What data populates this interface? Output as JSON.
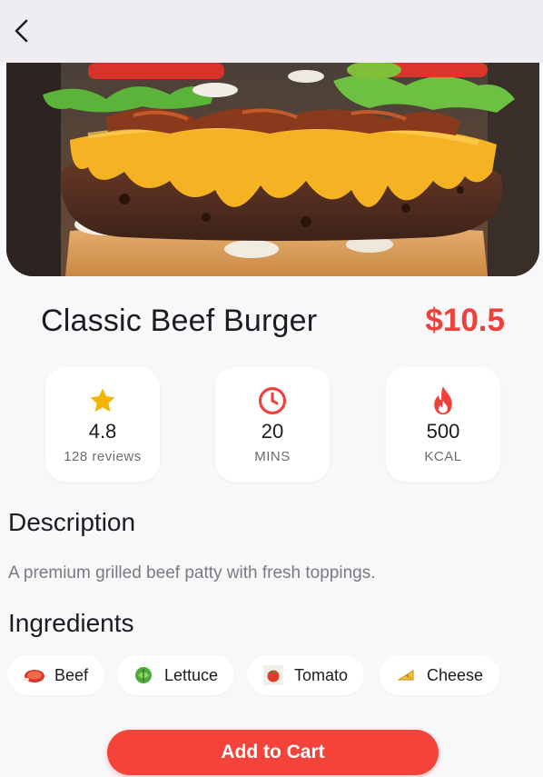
{
  "product": {
    "name": "Classic Beef Burger",
    "price": "$10.5"
  },
  "stats": [
    {
      "icon": "star-icon",
      "value": "4.8",
      "caption": "128 reviews"
    },
    {
      "icon": "clock-icon",
      "value": "20",
      "caption": "MINS"
    },
    {
      "icon": "fire-icon",
      "value": "500",
      "caption": "KCAL"
    }
  ],
  "description": {
    "heading": "Description",
    "text": "A premium grilled beef patty with fresh toppings."
  },
  "ingredients": {
    "heading": "Ingredients",
    "items": [
      {
        "icon": "meat-icon",
        "label": "Beef"
      },
      {
        "icon": "lettuce-icon",
        "label": "Lettuce"
      },
      {
        "icon": "tomato-icon",
        "label": "Tomato"
      },
      {
        "icon": "cheese-icon",
        "label": "Cheese"
      }
    ]
  },
  "cart_button": {
    "label": "Add to Cart"
  },
  "colors": {
    "accent": "#f4433a",
    "price": "#f0403a",
    "star": "#f5b400",
    "background": "#f8f7f9"
  }
}
